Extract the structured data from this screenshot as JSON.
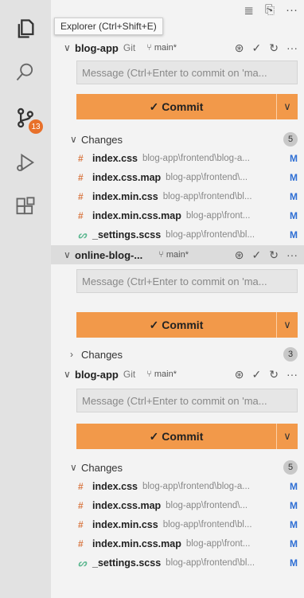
{
  "tooltip": "Explorer (Ctrl+Shift+E)",
  "activity_badge": "13",
  "top_tools": [
    "≣",
    "⎘",
    "···"
  ],
  "repos": [
    {
      "name": "blog-app",
      "kind": "Git",
      "branch": "main*",
      "message_placeholder": "Message (Ctrl+Enter to commit on 'ma...",
      "commit_label": "✓ Commit",
      "changes_label": "Changes",
      "changes_count": "5",
      "files": [
        {
          "name": "index.css",
          "path": "blog-app\\frontend\\blog-a...",
          "status": "M"
        },
        {
          "name": "index.css.map",
          "path": "blog-app\\frontend\\...",
          "status": "M"
        },
        {
          "name": "index.min.css",
          "path": "blog-app\\frontend\\bl...",
          "status": "M"
        },
        {
          "name": "index.min.css.map",
          "path": "blog-app\\front...",
          "status": "M"
        },
        {
          "name": "_settings.scss",
          "path": "blog-app\\frontend\\bl...",
          "status": "M"
        }
      ]
    },
    {
      "name": "online-blog-...",
      "kind": "",
      "branch": "main*",
      "message_placeholder": "Message (Ctrl+Enter to commit on 'ma...",
      "commit_label": "✓ Commit",
      "changes_label": "Changes",
      "changes_count": "3",
      "files": []
    },
    {
      "name": "blog-app",
      "kind": "Git",
      "branch": "main*",
      "message_placeholder": "Message (Ctrl+Enter to commit on 'ma...",
      "commit_label": "✓ Commit",
      "changes_label": "Changes",
      "changes_count": "5",
      "files": [
        {
          "name": "index.css",
          "path": "blog-app\\frontend\\blog-a...",
          "status": "M"
        },
        {
          "name": "index.css.map",
          "path": "blog-app\\frontend\\...",
          "status": "M"
        },
        {
          "name": "index.min.css",
          "path": "blog-app\\frontend\\bl...",
          "status": "M"
        },
        {
          "name": "index.min.css.map",
          "path": "blog-app\\front...",
          "status": "M"
        },
        {
          "name": "_settings.scss",
          "path": "blog-app\\frontend\\bl...",
          "status": "M"
        }
      ]
    }
  ]
}
